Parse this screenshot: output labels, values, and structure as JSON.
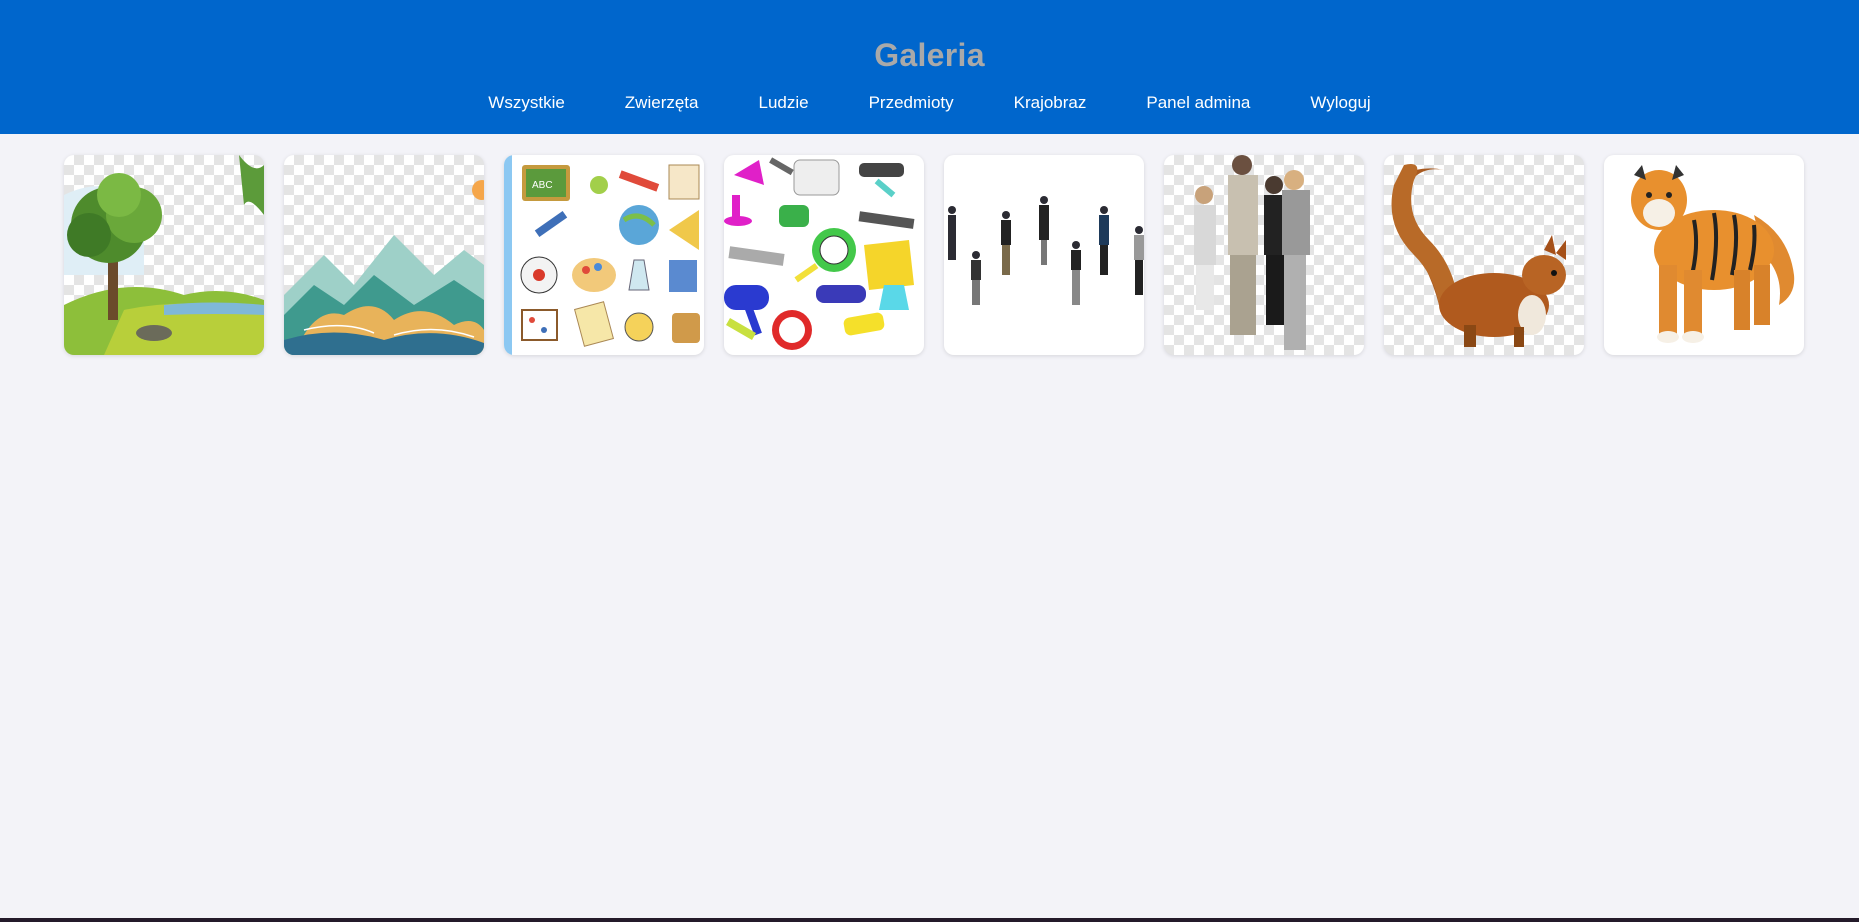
{
  "header": {
    "title": "Galeria",
    "nav": [
      {
        "label": "Wszystkie"
      },
      {
        "label": "Zwierzęta"
      },
      {
        "label": "Ludzie"
      },
      {
        "label": "Przedmioty"
      },
      {
        "label": "Krajobraz"
      },
      {
        "label": "Panel admina"
      },
      {
        "label": "Wyloguj"
      }
    ]
  },
  "colors": {
    "header_bg": "#0066cc",
    "title_color": "#a9a9a9",
    "page_bg": "#f3f3f8"
  },
  "gallery": {
    "items": [
      {
        "subject": "landscape-tree"
      },
      {
        "subject": "landscape-mountains"
      },
      {
        "subject": "school-objects"
      },
      {
        "subject": "household-objects"
      },
      {
        "subject": "people-crowd"
      },
      {
        "subject": "people-group"
      },
      {
        "subject": "squirrel"
      },
      {
        "subject": "tiger"
      }
    ]
  }
}
